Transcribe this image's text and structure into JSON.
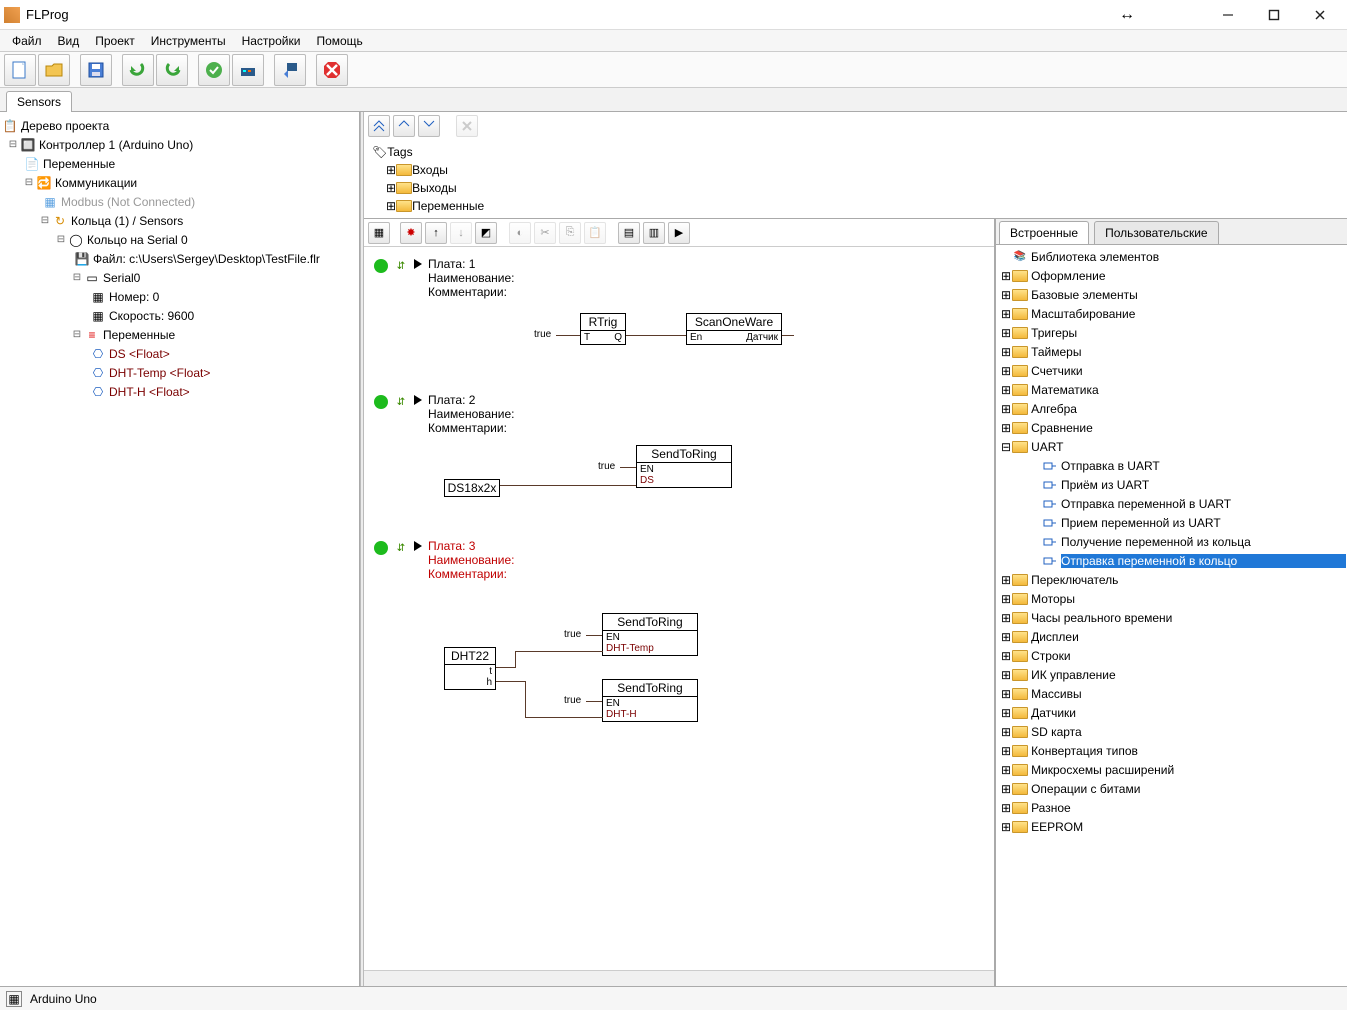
{
  "app_title": "FLProg",
  "menu": {
    "file": "Файл",
    "view": "Вид",
    "project": "Проект",
    "tools": "Инструменты",
    "settings": "Настройки",
    "help": "Помощь"
  },
  "tab_label": "Sensors",
  "project_tree": {
    "root": "Дерево проекта",
    "controller": "Контроллер 1 (Arduino Uno)",
    "vars": "Переменные",
    "comm": "Коммуникации",
    "modbus": "Modbus (Not Connected)",
    "rings": "Кольца (1) / Sensors",
    "ring": "Кольцо  на Serial 0",
    "file": "Файл: c:\\Users\\Sergey\\Desktop\\TestFile.flr",
    "serial0": "Serial0",
    "number": "Номер: 0",
    "speed": "Скорость: 9600",
    "varsnode": "Переменные",
    "var1": "DS <Float>",
    "var2": "DHT-Temp <Float>",
    "var3": "DHT-H <Float>"
  },
  "tags_panel": {
    "root": "Tags",
    "inputs": "Входы",
    "outputs": "Выходы",
    "vars": "Переменные"
  },
  "boards": {
    "b1": {
      "plate": "Плата: 1",
      "name": "Наименование:",
      "comment": "Комментарии:"
    },
    "b2": {
      "plate": "Плата: 2",
      "name": "Наименование:",
      "comment": "Комментарии:"
    },
    "b3": {
      "plate": "Плата: 3",
      "name": "Наименование:",
      "comment": "Комментарии:"
    }
  },
  "blocks": {
    "rtrig": "RTrig",
    "rtrig_t": "T",
    "rtrig_q": "Q",
    "scan": "ScanOneWare",
    "scan_en": "En",
    "scan_sensor": "Датчик",
    "true": "true",
    "sendtoring": "SendToRing",
    "en": "EN",
    "ds": "DS",
    "ds18": "DS18x2x",
    "dht22": "DHT22",
    "pin_t": "t",
    "pin_h": "h",
    "dht_temp": "DHT-Temp",
    "dht_h": "DHT-H"
  },
  "lib_tabs": {
    "builtin": "Встроенные",
    "user": "Пользовательские"
  },
  "library": {
    "root": "Библиотека элементов",
    "cats": [
      "Оформление",
      "Базовые элементы",
      "Масштабирование",
      "Тригеры",
      "Таймеры",
      "Счетчики",
      "Математика",
      "Алгебра",
      "Сравнение"
    ],
    "uart": "UART",
    "uart_items": [
      "Отправка в UART",
      "Приём из UART",
      "Отправка переменной в UART",
      "Прием переменной из UART",
      "Получение переменной из кольца",
      "Отправка переменной в кольцо"
    ],
    "cats2": [
      "Переключатель",
      "Моторы",
      "Часы реального времени",
      "Дисплеи",
      "Строки",
      "ИК управление",
      "Массивы",
      "Датчики",
      "SD карта",
      "Конвертация типов",
      "Микросхемы расширений",
      "Операции с битами",
      "Разное",
      "EEPROM"
    ],
    "selected_index": 5
  },
  "statusbar": "Arduino Uno"
}
